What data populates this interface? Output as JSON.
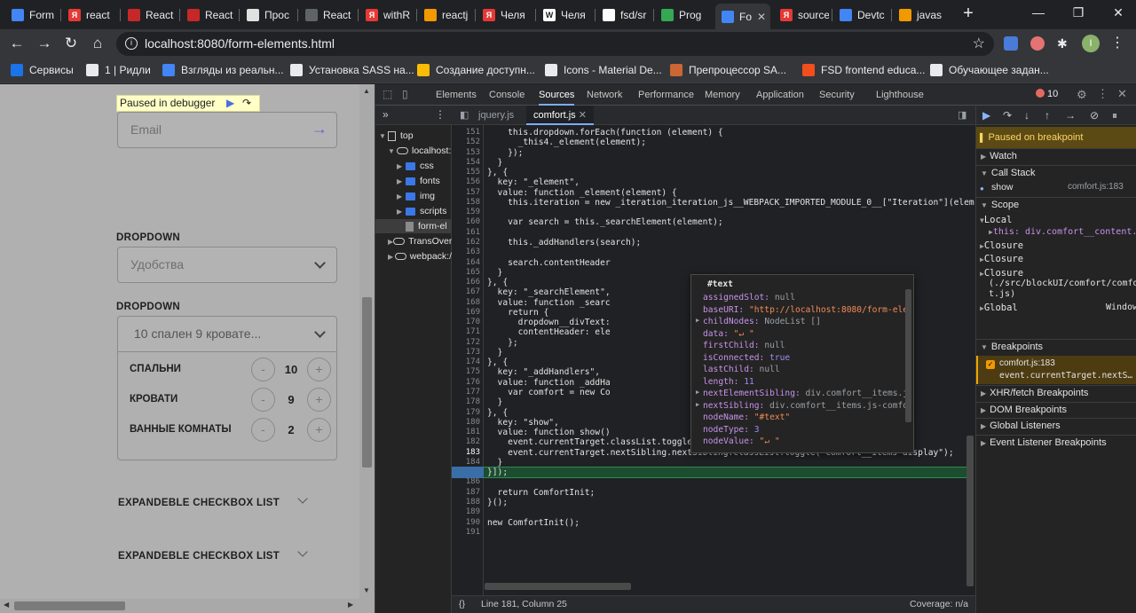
{
  "tabs": [
    {
      "label": "Form",
      "favicon_color": "#4285f4",
      "fav_text": ""
    },
    {
      "label": "react",
      "favicon_color": "#e53935",
      "fav_text": "Я"
    },
    {
      "label": "React",
      "favicon_color": "#c62828",
      "fav_text": ""
    },
    {
      "label": "React",
      "favicon_color": "#c62828",
      "fav_text": ""
    },
    {
      "label": "Прос",
      "favicon_color": "#e0e0e0",
      "fav_text": ""
    },
    {
      "label": "React",
      "favicon_color": "#5f6368",
      "fav_text": ""
    },
    {
      "label": "withR",
      "favicon_color": "#e53935",
      "fav_text": "Я"
    },
    {
      "label": "reactj",
      "favicon_color": "#f29900",
      "fav_text": ""
    },
    {
      "label": "Челя",
      "favicon_color": "#e53935",
      "fav_text": "Я"
    },
    {
      "label": "Челя",
      "favicon_color": "#ffffff",
      "fav_text": "W"
    },
    {
      "label": "fsd/sr",
      "favicon_color": "#ffffff",
      "fav_text": ""
    },
    {
      "label": "Prog",
      "favicon_color": "#34a853",
      "fav_text": ""
    },
    {
      "label": "Fo",
      "favicon_color": "#4285f4",
      "fav_text": "",
      "active": true
    },
    {
      "label": "source",
      "favicon_color": "#e53935",
      "fav_text": "Я"
    },
    {
      "label": "Devtc",
      "favicon_color": "#4285f4",
      "fav_text": ""
    },
    {
      "label": "javas",
      "favicon_color": "#f29900",
      "fav_text": ""
    }
  ],
  "address": {
    "url": "localhost:8080/form-elements.html"
  },
  "bookmarks": [
    {
      "label": "Сервисы",
      "icon_color": "#1a73e8"
    },
    {
      "label": "1 | Ридли",
      "icon_color": "#e8eaed"
    },
    {
      "label": "Взгляды из реальн...",
      "icon_color": "#4285f4"
    },
    {
      "label": "Установка SASS на...",
      "icon_color": "#e8eaed"
    },
    {
      "label": "Создание доступн...",
      "icon_color": "#fbbc04"
    },
    {
      "label": "Icons - Material De...",
      "icon_color": "#e8eaed"
    },
    {
      "label": "Препроцессор SA...",
      "icon_color": "#cc6633"
    },
    {
      "label": "FSD frontend educa...",
      "icon_color": "#f24e1e"
    },
    {
      "label": "Обучающее задан...",
      "icon_color": "#e8eaed"
    }
  ],
  "page": {
    "paused_label": "Paused in debugger",
    "email_placeholder": "Email",
    "dropdown1_label": "DROPDOWN",
    "dropdown1_value": "Удобства",
    "dropdown2_label": "DROPDOWN",
    "dropdown2_value": "10 спален 9 кровате...",
    "counters": [
      {
        "label": "СПАЛЬНИ",
        "value": "10"
      },
      {
        "label": "КРОВАТИ",
        "value": "9"
      },
      {
        "label": "ВАННЫЕ КОМНАТЫ",
        "value": "2"
      }
    ],
    "minus": "-",
    "plus": "+",
    "expandable1": "EXPANDEBLE CHECKBOX LIST",
    "expandable2": "EXPANDEBLE CHECKBOX LIST"
  },
  "devtools": {
    "tabs": [
      "Elements",
      "Console",
      "Sources",
      "Network",
      "Performance",
      "Memory",
      "Application",
      "Security",
      "Lighthouse"
    ],
    "active_tab": "Sources",
    "error_count": "10",
    "tree": [
      {
        "label": "top",
        "indent": 0
      },
      {
        "label": "localhost:",
        "indent": 1
      },
      {
        "label": "css",
        "indent": 2
      },
      {
        "label": "fonts",
        "indent": 2
      },
      {
        "label": "img",
        "indent": 2
      },
      {
        "label": "scripts",
        "indent": 2
      },
      {
        "label": "form-el",
        "indent": 2
      },
      {
        "label": "TransOver",
        "indent": 1
      },
      {
        "label": "webpack:/",
        "indent": 1
      }
    ],
    "file_tabs": [
      "jquery.js",
      "comfort.js"
    ],
    "code_lines": [
      {
        "n": "151",
        "t": "    this.dropdown.forEach(function (element) {"
      },
      {
        "n": "152",
        "t": "      _this4._element(element);"
      },
      {
        "n": "153",
        "t": "    });"
      },
      {
        "n": "154",
        "t": "  }"
      },
      {
        "n": "155",
        "t": "}, {"
      },
      {
        "n": "156",
        "t": "  key: \"_element\","
      },
      {
        "n": "157",
        "t": "  value: function _element(element) {"
      },
      {
        "n": "158",
        "t": "    this.iteration = new _iteration_iteration_js__WEBPACK_IMPORTED_MODULE_0__[\"Iteration\"](elem"
      },
      {
        "n": "159",
        "t": ""
      },
      {
        "n": "160",
        "t": "    var search = this._searchElement(element);"
      },
      {
        "n": "161",
        "t": ""
      },
      {
        "n": "162",
        "t": "    this._addHandlers(search);"
      },
      {
        "n": "163",
        "t": ""
      },
      {
        "n": "164",
        "t": "    search.contentHeader"
      },
      {
        "n": "165",
        "t": "  }"
      },
      {
        "n": "166",
        "t": "}, {"
      },
      {
        "n": "167",
        "t": "  key: \"_searchElement\","
      },
      {
        "n": "168",
        "t": "  value: function _searc"
      },
      {
        "n": "169",
        "t": "    return {"
      },
      {
        "n": "170",
        "t": "      dropdown__divText:"
      },
      {
        "n": "171",
        "t": "      contentHeader: ele"
      },
      {
        "n": "172",
        "t": "    };"
      },
      {
        "n": "173",
        "t": "  }"
      },
      {
        "n": "174",
        "t": "}, {"
      },
      {
        "n": "175",
        "t": "  key: \"_addHandlers\","
      },
      {
        "n": "176",
        "t": "  value: function _addHa"
      },
      {
        "n": "177",
        "t": "    var comfort = new Co"
      },
      {
        "n": "178",
        "t": "  }"
      },
      {
        "n": "179",
        "t": "}, {"
      },
      {
        "n": "180",
        "t": "  key: \"show\","
      },
      {
        "n": "181",
        "t": "  value: function show()"
      },
      {
        "n": "182",
        "t": "    event.currentTarget.classList.toggle(\"comfort__content-border\");"
      },
      {
        "n": "183",
        "t": "    event.currentTarget.nextSibling.nextSibling.classList.toggle(\"comfort__items-display\");"
      },
      {
        "n": "184",
        "t": "  }"
      },
      {
        "n": "185",
        "t": "}]);"
      },
      {
        "n": "186",
        "t": ""
      },
      {
        "n": "187",
        "t": "  return ComfortInit;"
      },
      {
        "n": "188",
        "t": "}();"
      },
      {
        "n": "189",
        "t": ""
      },
      {
        "n": "190",
        "t": "new ComfortInit();"
      },
      {
        "n": "191",
        "t": ""
      }
    ],
    "popover": {
      "title": "#text",
      "props": [
        {
          "k": "assignedSlot",
          "v": "null",
          "kind": "n"
        },
        {
          "k": "baseURI",
          "v": "\"http://localhost:8080/form-ele",
          "kind": "s"
        },
        {
          "k": "childNodes",
          "v": "NodeList []",
          "kind": "n",
          "expand": true
        },
        {
          "k": "data",
          "v": "\"↵        \"",
          "kind": "s"
        },
        {
          "k": "firstChild",
          "v": "null",
          "kind": "n"
        },
        {
          "k": "isConnected",
          "v": "true",
          "kind": "b"
        },
        {
          "k": "lastChild",
          "v": "null",
          "kind": "n"
        },
        {
          "k": "length",
          "v": "11",
          "kind": "num"
        },
        {
          "k": "nextElementSibling",
          "v": "div.comfort__items.j",
          "kind": "n",
          "expand": true
        },
        {
          "k": "nextSibling",
          "v": "div.comfort__items.js-comfo",
          "kind": "n",
          "expand": true
        },
        {
          "k": "nodeName",
          "v": "\"#text\"",
          "kind": "s"
        },
        {
          "k": "nodeType",
          "v": "3",
          "kind": "num"
        },
        {
          "k": "nodeValue",
          "v": "\"↵        \"",
          "kind": "s"
        }
      ]
    },
    "status": {
      "position": "Line 181, Column 25",
      "coverage": "Coverage: n/a"
    },
    "sidebar": {
      "paused": "Paused on breakpoint",
      "watch": "Watch",
      "call_stack": "Call Stack",
      "frame_name": "show",
      "frame_loc": "comfort.js:183",
      "scope": "Scope",
      "local": "Local",
      "this_val": "this: div.comfort__content.js",
      "closure1": "Closure",
      "closure2": "Closure",
      "closure3": "Closure",
      "closure3_path": "(./src/blockUI/comfort/comfor",
      "closure3_path2": "t.js)",
      "global": "Global",
      "global_val": "Window",
      "breakpoints": "Breakpoints",
      "bp_file": "comfort.js:183",
      "bp_code": "event.currentTarget.nextS…",
      "xhr": "XHR/fetch Breakpoints",
      "dom": "DOM Breakpoints",
      "global_listeners": "Global Listeners",
      "event_listener": "Event Listener Breakpoints"
    }
  }
}
